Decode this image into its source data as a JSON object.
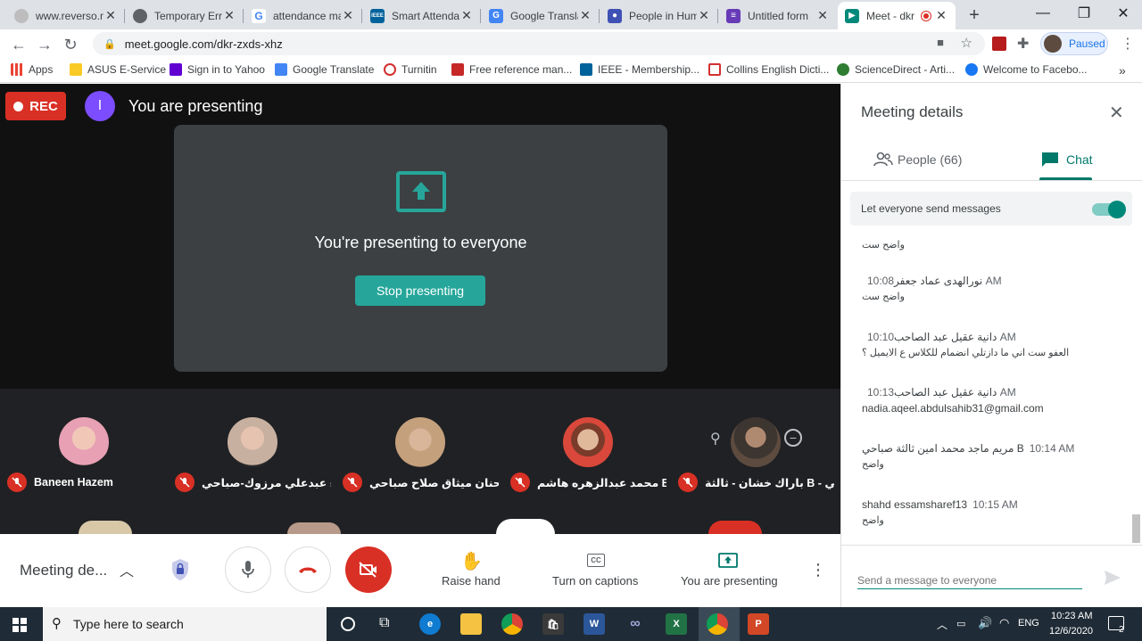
{
  "browser": {
    "tabs": [
      {
        "title": "www.reverso.n",
        "icon": "reverso-icon",
        "color": "#9e9e9e"
      },
      {
        "title": "Temporary Erro",
        "icon": "globe-icon",
        "color": "#5f6368"
      },
      {
        "title": "attendance ma",
        "icon": "google-icon",
        "color": "#4285f4"
      },
      {
        "title": "Smart Attenda",
        "icon": "ieee-icon",
        "color": "#00629b"
      },
      {
        "title": "Google Transla",
        "icon": "translate-icon",
        "color": "#4285f4"
      },
      {
        "title": "People in Hum",
        "icon": "people-icon",
        "color": "#3f51b5"
      },
      {
        "title": "Untitled form",
        "icon": "forms-icon",
        "color": "#673ab7"
      },
      {
        "title": "Meet - dkr",
        "icon": "meet-icon",
        "color": "#00897b",
        "active": true
      }
    ],
    "new_tab": "+",
    "url": "meet.google.com/dkr-zxds-xhz",
    "profile_status": "Paused",
    "bookmarks": [
      {
        "label": "Apps",
        "icon": "apps-grid-icon",
        "color": "#ea4335"
      },
      {
        "label": "ASUS E-Service",
        "icon": "folder-icon",
        "color": "#f9ca24"
      },
      {
        "label": "Sign in to Yahoo",
        "icon": "yahoo-icon",
        "color": "#6001d2"
      },
      {
        "label": "Google Translate",
        "icon": "translate-icon",
        "color": "#4285f4"
      },
      {
        "label": "Turnitin",
        "icon": "turnitin-icon",
        "color": "#d32f2f"
      },
      {
        "label": "Free reference man...",
        "icon": "mendeley-icon",
        "color": "#c62828"
      },
      {
        "label": "IEEE - Membership...",
        "icon": "ieee-icon",
        "color": "#00629b"
      },
      {
        "label": "Collins English Dicti...",
        "icon": "collins-icon",
        "color": "#d32f2f"
      },
      {
        "label": "ScienceDirect - Arti...",
        "icon": "sciencedirect-icon",
        "color": "#2e7d32"
      },
      {
        "label": "Welcome to Facebo...",
        "icon": "facebook-icon",
        "color": "#1877f2"
      }
    ],
    "more_bookmarks": "»"
  },
  "meet": {
    "rec_label": "REC",
    "avatar_initial": "I",
    "you_are_presenting": "You are presenting",
    "presenting_message": "You're presenting to everyone",
    "stop_presenting": "Stop presenting",
    "participants": [
      {
        "name": "Baneen Hazem",
        "color": "#e8a0b4"
      },
      {
        "name": "اء عبدعلي مرزوك-صباحي-A...",
        "color": "#b89a8a"
      },
      {
        "name": "حنان ميثاق صلاح صباحي A",
        "color": "#c4a07c"
      },
      {
        "name": "محمد عبدالزهره هاشم B",
        "color": "#d9483b"
      },
      {
        "name": "باراك خشان - ثالثة B - صباحي...",
        "color": "#5d4b3f"
      }
    ],
    "controls": {
      "meeting_details": "Meeting de...",
      "raise_hand": "Raise hand",
      "captions": "Turn on captions",
      "presenting": "You are presenting"
    }
  },
  "panel": {
    "title": "Meeting details",
    "people_tab": "People (66)",
    "chat_tab": "Chat",
    "toggle_label": "Let everyone send messages",
    "toggle_on": true,
    "messages": [
      {
        "sender": "",
        "time": "",
        "body": "واضح ست"
      },
      {
        "sender": "نورالهدى عماد جعفر",
        "time": "10:08 AM",
        "body": "واضح ست"
      },
      {
        "sender": "دانية عقيل عبد الصاحب",
        "time": "10:10 AM",
        "body": "العفو ست اني ما دازتلي  انضمام للكلاس ع الايميل ؟"
      },
      {
        "sender": "دانية عقيل عبد الصاحب",
        "time": "10:13 AM",
        "body": "nadia.aqeel.abdulsahib31@gmail.com"
      },
      {
        "sender": "مريم ماجد محمد امين ثالثة صباحي B",
        "time": "10:14 AM",
        "body": "واضح"
      },
      {
        "sender": "shahd essamsharef13",
        "time": "10:15 AM",
        "body": "واضح"
      }
    ],
    "send_placeholder": "Send a message to everyone"
  },
  "taskbar": {
    "search_placeholder": "Type here to search",
    "language": "ENG",
    "time": "10:23 AM",
    "date": "12/6/2020",
    "notifications": "2"
  },
  "colors": {
    "accent_teal": "#00897b",
    "rec_red": "#d93025",
    "meet_dark": "#202124"
  }
}
